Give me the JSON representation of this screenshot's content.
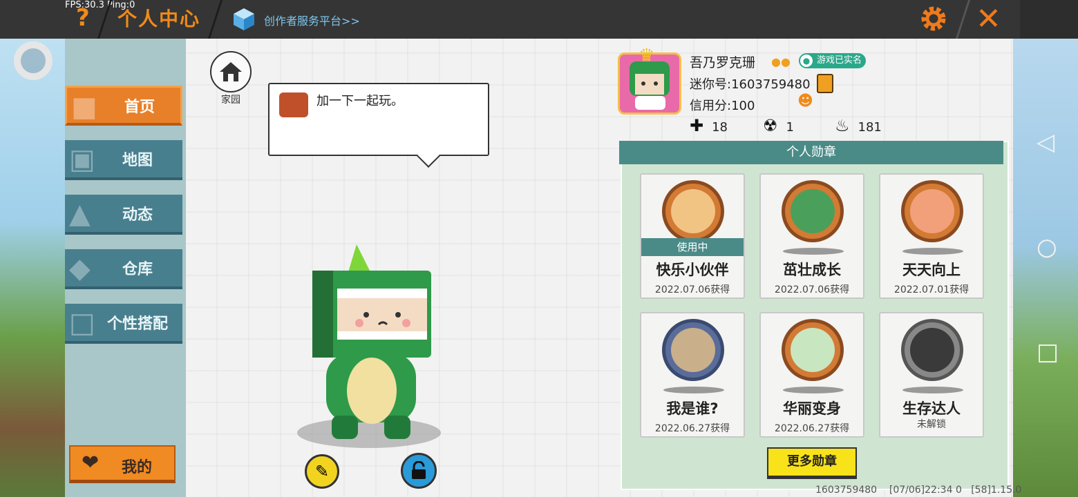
{
  "debug": {
    "fps_ping": "FPS:30.3  Ping:0"
  },
  "header": {
    "help_label": "?",
    "title": "个人中心",
    "creator_link": "创作者服务平台>>",
    "close_label": "✕"
  },
  "sidebar": {
    "items": [
      {
        "label": "首页",
        "icon": "shirt-icon",
        "active": true
      },
      {
        "label": "地图",
        "icon": "image-icon"
      },
      {
        "label": "动态",
        "icon": "bell-icon"
      },
      {
        "label": "仓库",
        "icon": "box-icon"
      },
      {
        "label": "个性搭配",
        "icon": "dress-up-icon"
      }
    ],
    "mine_label": "我的"
  },
  "main": {
    "home_label": "家园",
    "bubble_text": "加一下一起玩。"
  },
  "profile": {
    "name": "吾乃罗克珊",
    "verified": "游戏已实名",
    "mini_id": "迷你号:1603759480",
    "credit": "信用分:100",
    "stats": {
      "followers": "18",
      "likes": "1",
      "heat": "181"
    }
  },
  "badges": {
    "header": "个人勋章",
    "in_use": "使用中",
    "items": [
      {
        "name": "快乐小伙伴",
        "date": "2022.07.06获得"
      },
      {
        "name": "茁壮成长",
        "date": "2022.07.06获得"
      },
      {
        "name": "天天向上",
        "date": "2022.07.01获得"
      },
      {
        "name": "我是谁?",
        "date": "2022.06.27获得"
      },
      {
        "name": "华丽变身",
        "date": "2022.06.27获得"
      },
      {
        "name": "生存达人",
        "date": "未解锁"
      }
    ],
    "more_label": "更多勋章"
  },
  "footer": {
    "text": "1603759480    [07/06]22:34 0   [58]1.15.0"
  },
  "colors": {
    "accent": "#f08a1a",
    "teal": "#4a8b88",
    "panel": "#cfe5d2"
  }
}
